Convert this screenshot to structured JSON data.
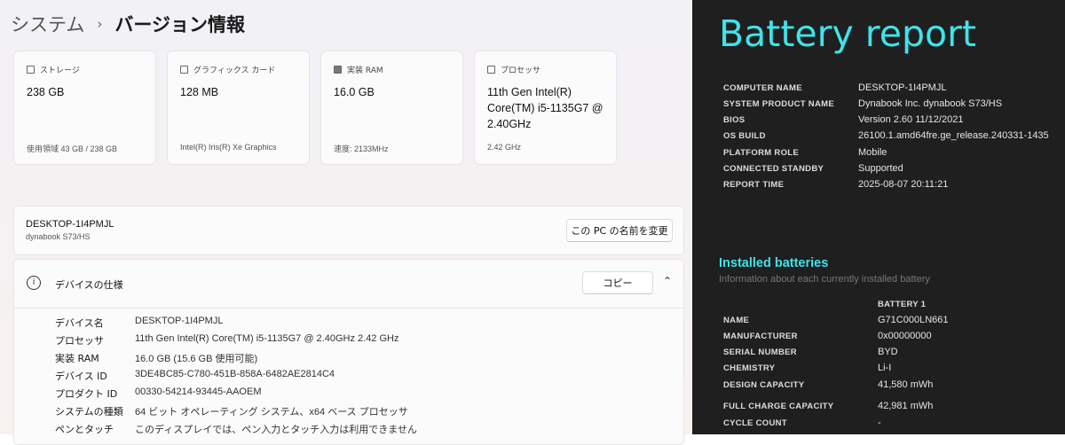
{
  "settings": {
    "breadcrumb": {
      "parent": "システム",
      "separator": "›",
      "current": "バージョン情報"
    },
    "cards": [
      {
        "label": "ストレージ",
        "icon": "storage-icon",
        "value": "238 GB",
        "footer": "使用領域 43 GB / 238 GB"
      },
      {
        "label": "グラフィックス カード",
        "icon": "graphics-card-icon",
        "value": "128 MB",
        "footer": "Intel(R) Iris(R) Xe Graphics"
      },
      {
        "label": "実装 RAM",
        "icon": "ram-icon",
        "value": "16.0 GB",
        "footer": "速度: 2133MHz"
      },
      {
        "label": "プロセッサ",
        "icon": "processor-icon",
        "value": "11th Gen Intel(R) Core(TM) i5-1135G7 @ 2.40GHz",
        "footer": "2.42 GHz"
      }
    ],
    "pc": {
      "name": "DESKTOP-1I4PMJL",
      "model": "dynabook S73/HS",
      "rename_label": "この PC の名前を変更"
    },
    "spec": {
      "title": "デバイスの仕様",
      "copy_label": "コピー",
      "rows": [
        {
          "k": "デバイス名",
          "v": "DESKTOP-1I4PMJL"
        },
        {
          "k": "プロセッサ",
          "v": "11th Gen Intel(R) Core(TM) i5-1135G7 @ 2.40GHz   2.42 GHz"
        },
        {
          "k": "実装 RAM",
          "v": "16.0 GB (15.6 GB 使用可能)"
        },
        {
          "k": "デバイス ID",
          "v": "3DE4BC85-C780-451B-858A-6482AE2814C4"
        },
        {
          "k": "プロダクト ID",
          "v": "00330-54214-93445-AAOEM"
        },
        {
          "k": "システムの種類",
          "v": "64 ビット オペレーティング システム、x64 ベース プロセッサ"
        },
        {
          "k": "ペンとタッチ",
          "v": "このディスプレイでは、ペン入力とタッチ入力は利用できません"
        }
      ]
    }
  },
  "report": {
    "title": "Battery report",
    "system": [
      {
        "k": "COMPUTER NAME",
        "v": "DESKTOP-1I4PMJL"
      },
      {
        "k": "SYSTEM PRODUCT NAME",
        "v": "Dynabook Inc. dynabook S73/HS"
      },
      {
        "k": "BIOS",
        "v": "Version 2.60 11/12/2021"
      },
      {
        "k": "OS BUILD",
        "v": "26100.1.amd64fre.ge_release.240331-1435"
      },
      {
        "k": "PLATFORM ROLE",
        "v": "Mobile"
      },
      {
        "k": "CONNECTED STANDBY",
        "v": "Supported"
      },
      {
        "k": "REPORT TIME",
        "v": "2025-08-07  20:11:21"
      }
    ],
    "batteries": {
      "title": "Installed batteries",
      "subtitle": "Information about each currently installed battery",
      "column": "BATTERY 1",
      "rows": [
        {
          "k": "NAME",
          "v": "G71C000LN661"
        },
        {
          "k": "MANUFACTURER",
          "v": "0x00000000"
        },
        {
          "k": "SERIAL NUMBER",
          "v": "BYD"
        },
        {
          "k": "CHEMISTRY",
          "v": "Li-I"
        },
        {
          "k": "DESIGN CAPACITY",
          "v": "41,580 mWh"
        },
        {
          "k": "FULL CHARGE CAPACITY",
          "v": "42,981 mWh"
        },
        {
          "k": "CYCLE COUNT",
          "v": "-"
        }
      ]
    },
    "accent": "#3fe3ea"
  }
}
